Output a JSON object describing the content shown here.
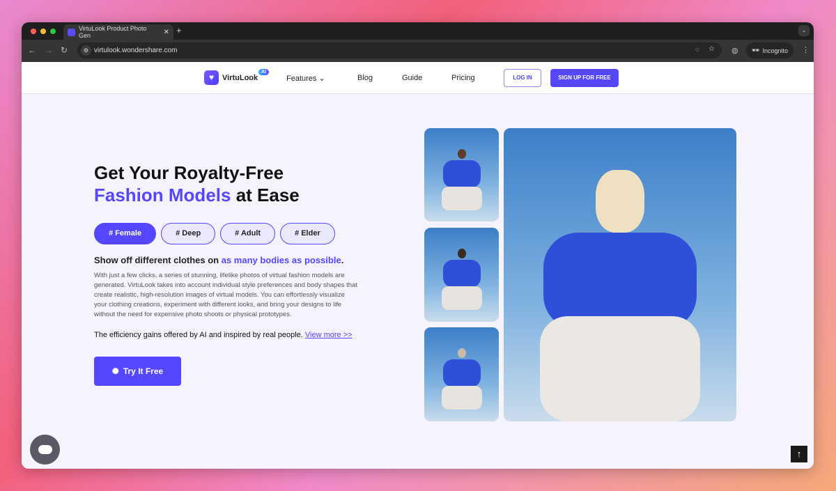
{
  "browser": {
    "tab_title": "VirtuLook Product Photo Gen",
    "url": "virtulook.wondershare.com",
    "profile": "Incognito"
  },
  "nav": {
    "brand": "VirtuLook",
    "badge": "AI",
    "items": [
      "Features",
      "Blog",
      "Guide",
      "Pricing"
    ],
    "login": "LOG IN",
    "signup": "SIGN UP FOR FREE"
  },
  "hero": {
    "title_line1": "Get Your Royalty-Free",
    "title_accent": "Fashion Models",
    "title_rest": " at Ease",
    "tags": [
      "# Female",
      "# Deep",
      "# Adult",
      "# Elder"
    ],
    "sub_plain": "Show off different clothes on ",
    "sub_accent": "as many bodies as possible",
    "sub_end": ".",
    "body": "With just a few clicks, a series of stunning, lifelike photos of virtual fashion models are generated. VirtuLook takes into account individual style preferences and body shapes that create realistic, high-resolution images of virtual models. You can effortlessly visualize your clothing creations, experiment with different looks, and bring your designs to life without the need for expensive photo shoots or physical prototypes.",
    "efficiency": "The efficiency gains offered by AI and inspired by real people. ",
    "view_more": "View more >>",
    "cta": "Try It Free"
  },
  "colors": {
    "accent": "#5546ff"
  }
}
